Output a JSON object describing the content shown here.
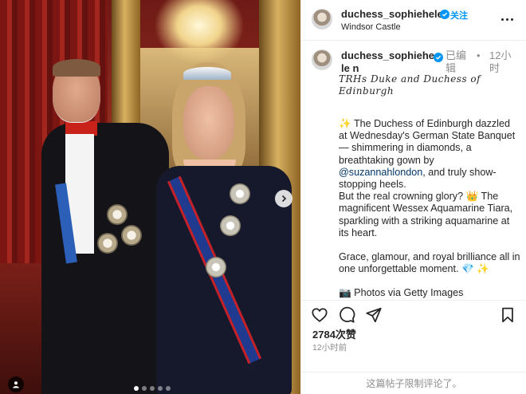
{
  "post": {
    "header": {
      "username": "duchess_sophiehelen",
      "follow_label": "关注",
      "location": "Windsor Castle"
    },
    "caption": {
      "username": "duchess_sophiehele n",
      "edited_label": "已编辑",
      "separator": "•",
      "time": "12小时",
      "script_line": "TRHs Duke and Duchess of Edinburgh",
      "paragraph1_pre": "✨ The Duchess of Edinburgh dazzled at Wednesday's German State Banquet — shimmering in diamonds, a breathtaking gown by ",
      "mention": "@suzannahlondon",
      "paragraph1_post": ", and truly show-stopping heels.",
      "paragraph2": "But the real crowning glory? 👑 The magnificent Wessex Aquamarine Tiara, sparkling with a striking aquamarine at its heart.",
      "paragraph3": "Grace, glamour, and royal brilliance all in one unforgettable moment. 💎 ✨",
      "credit": "📷 Photos via Getty Images"
    },
    "likes": "2784次赞",
    "time_ago": "12小时前",
    "comments_disabled": "这篇帖子限制评论了。"
  },
  "carousel": {
    "count": 5,
    "active_index": 0
  },
  "icons": {
    "verified": "verified-badge-icon",
    "more": "more-options-icon",
    "like": "heart-icon",
    "comment": "comment-icon",
    "share": "share-icon",
    "save": "bookmark-icon",
    "next": "chevron-right-icon",
    "tag": "user-tag-icon"
  },
  "colors": {
    "link": "#0095f6",
    "mention": "#00376b",
    "muted": "#8e8e8e",
    "text": "#262626"
  }
}
